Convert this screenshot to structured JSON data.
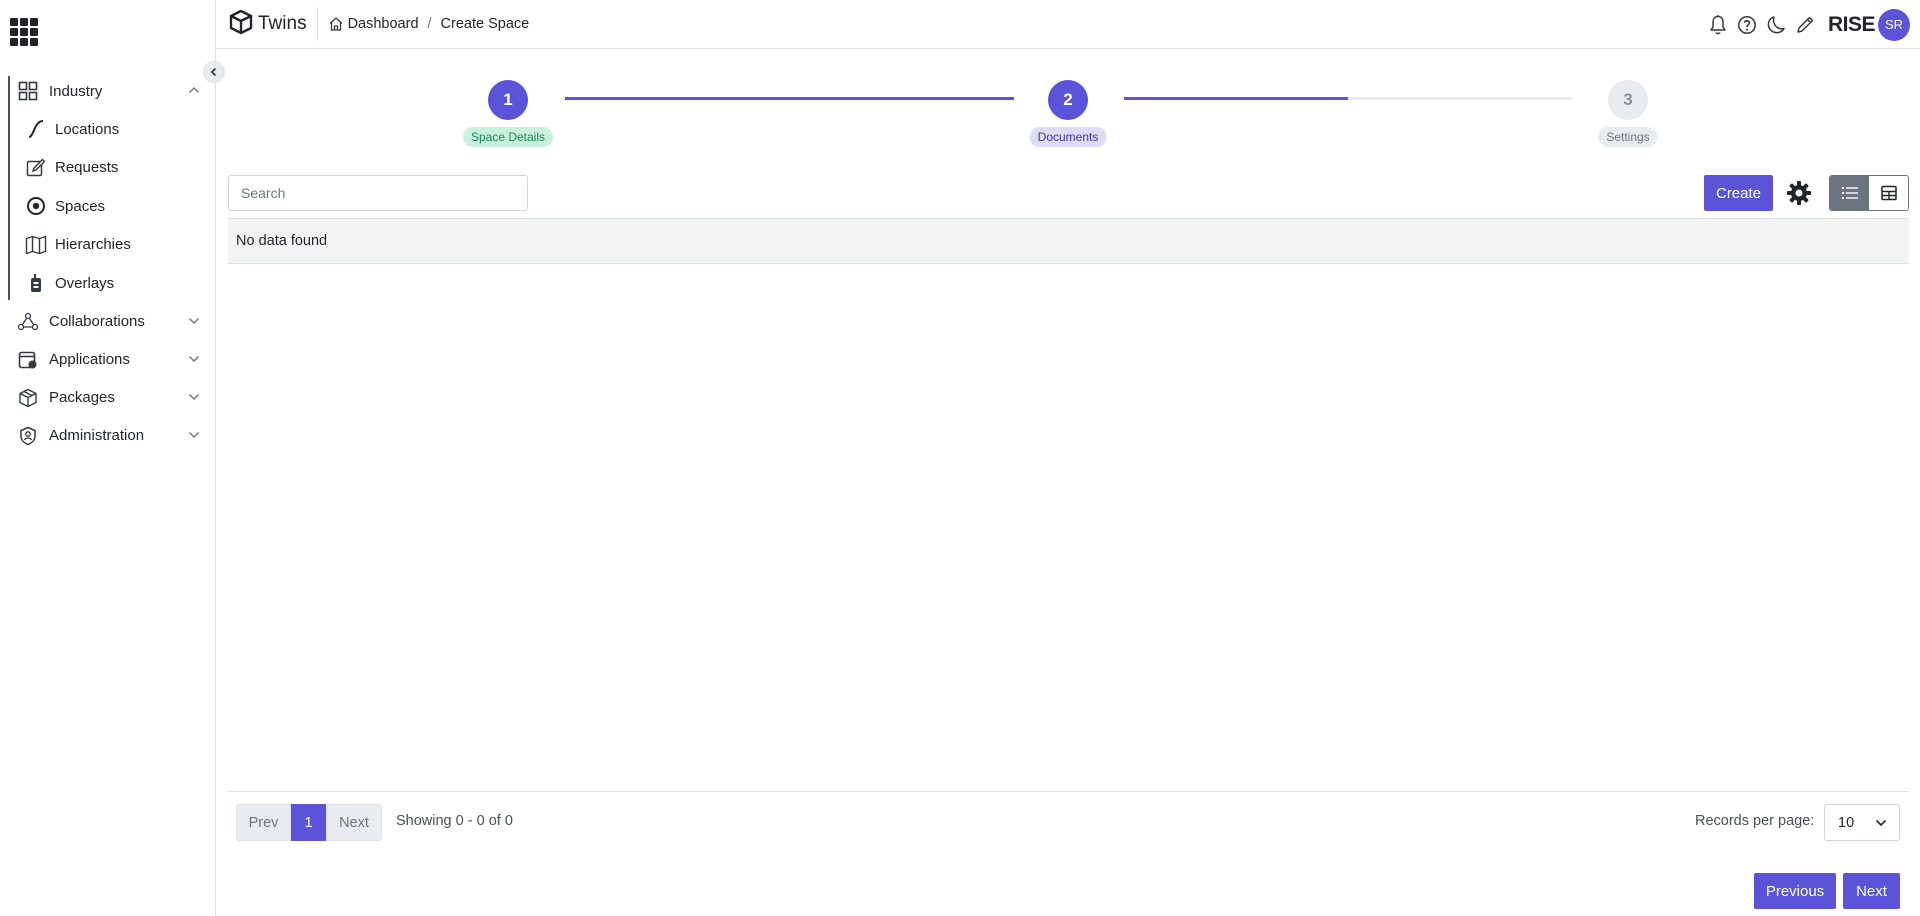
{
  "app": {
    "name": "Twins",
    "org": "RISE",
    "user_initials": "SR"
  },
  "breadcrumb": {
    "home": "Dashboard",
    "separator": "/",
    "current": "Create Space"
  },
  "sidebar": {
    "groups": [
      {
        "label": "Industry",
        "icon": "grid-icon",
        "expanded": true,
        "items": [
          {
            "label": "Locations",
            "icon": "path-icon"
          },
          {
            "label": "Requests",
            "icon": "edit-icon"
          },
          {
            "label": "Spaces",
            "icon": "target-icon"
          },
          {
            "label": "Hierarchies",
            "icon": "map-icon"
          },
          {
            "label": "Overlays",
            "icon": "device-icon"
          }
        ]
      },
      {
        "label": "Collaborations",
        "icon": "network-icon",
        "expanded": false
      },
      {
        "label": "Applications",
        "icon": "app-window-icon",
        "expanded": false
      },
      {
        "label": "Packages",
        "icon": "box-icon",
        "expanded": false
      },
      {
        "label": "Administration",
        "icon": "shield-user-icon",
        "expanded": false
      }
    ]
  },
  "stepper": {
    "steps": [
      {
        "number": "1",
        "label": "Space Details",
        "state": "done"
      },
      {
        "number": "2",
        "label": "Documents",
        "state": "current"
      },
      {
        "number": "3",
        "label": "Settings",
        "state": "todo"
      }
    ],
    "progress": [
      1.0,
      0.5
    ]
  },
  "toolbar": {
    "search_placeholder": "Search",
    "create_label": "Create",
    "view_mode": "list"
  },
  "table": {
    "empty_message": "No data found"
  },
  "pagination": {
    "prev_label": "Prev",
    "current_page": "1",
    "next_label": "Next",
    "showing_text": "Showing 0 - 0 of 0",
    "records_per_page_label": "Records per page:",
    "records_per_page_value": "10"
  },
  "wizard_nav": {
    "previous_label": "Previous",
    "next_label": "Next"
  },
  "colors": {
    "accent": "#5b54d8",
    "success_bg": "#c8f0dc",
    "muted": "#e9ecef"
  }
}
